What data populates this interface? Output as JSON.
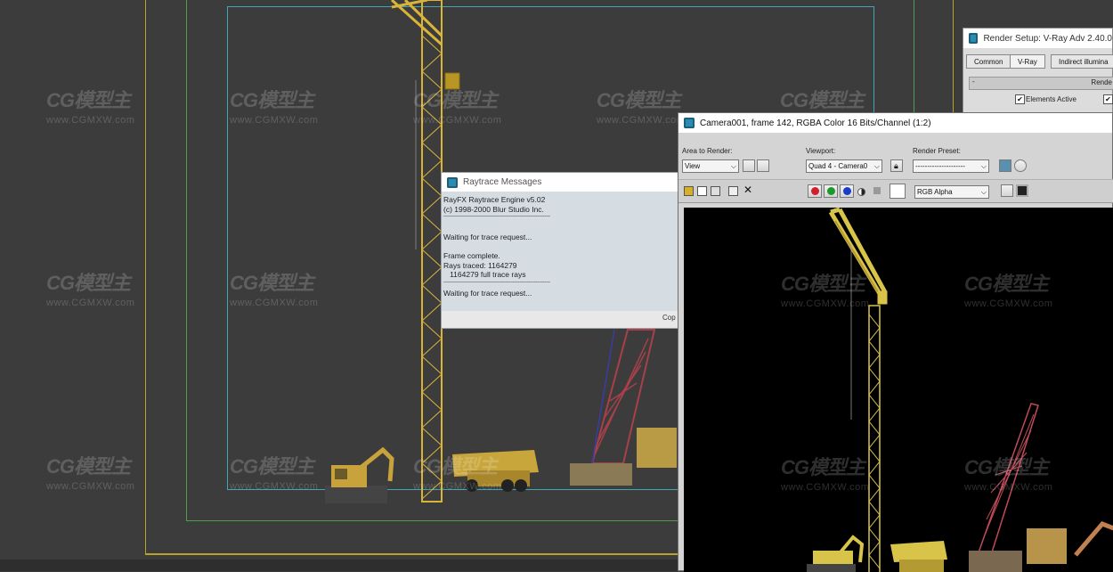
{
  "watermark": {
    "logo": "CG模型主",
    "url": "www.CGMXW.com"
  },
  "raytrace": {
    "title": "Raytrace Messages",
    "lines": [
      "RayFX Raytrace Engine v5.02",
      "(c) 1998-2000 Blur Studio Inc.",
      "------------------------------------------------------------",
      "",
      "Waiting for trace request...",
      "",
      "Frame complete.",
      "Rays traced: 1164279",
      "   1164279 full trace rays",
      "------------------------------------------------------------",
      "Waiting for trace request...",
      ""
    ],
    "copy_label": "Cop"
  },
  "render_setup": {
    "title": "Render Setup: V-Ray Adv 2.40.0",
    "tabs": [
      "Common",
      "V-Ray",
      "Indirect illumina"
    ],
    "rollout_label": "Rende",
    "elements_active_label": "Elements Active"
  },
  "frame_window": {
    "title": "Camera001, frame 142, RGBA Color 16 Bits/Channel (1:2)",
    "area_to_render_label": "Area to Render:",
    "area_value": "View",
    "viewport_label": "Viewport:",
    "viewport_value": "Quad 4 - Camera0",
    "preset_label": "Render Preset:",
    "preset_value": "---------------------",
    "channel_value": "RGB Alpha"
  },
  "colors": {
    "viewport_bg": "#3c3c3c",
    "crane_yellow": "#d9b43a",
    "crane_red": "#a8404a"
  }
}
